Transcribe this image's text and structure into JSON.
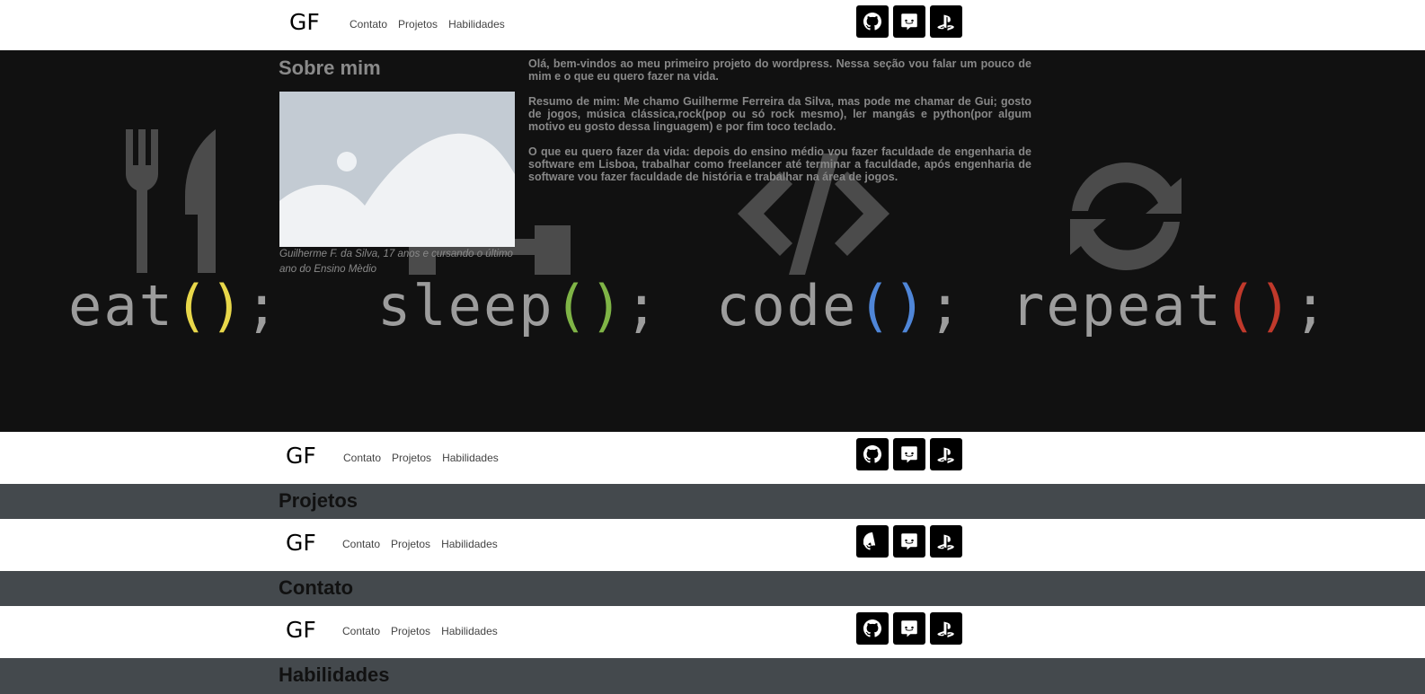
{
  "brand": {
    "logo": "GF"
  },
  "nav": {
    "contato": "Contato",
    "projetos": "Projetos",
    "habilidades": "Habilidades"
  },
  "social": [
    {
      "name": "github",
      "icon": "github-icon"
    },
    {
      "name": "discord",
      "icon": "discord-icon"
    },
    {
      "name": "playstation",
      "icon": "playstation-icon"
    }
  ],
  "hero": {
    "words": [
      "eat",
      "sleep",
      "code",
      "repeat"
    ],
    "paren_open": "(",
    "paren_close": ")",
    "semicolon": ";",
    "paren_colors": [
      "#e8d74a",
      "#7fb446",
      "#4f86d8",
      "#c0392b"
    ],
    "icons": [
      "fork-knife-icon",
      "bed-icon",
      "code-brackets-icon",
      "refresh-icon"
    ]
  },
  "about": {
    "title": "Sobre mim",
    "caption": "Guilherme F. da Silva, 17 anos e cursando o último ano do Ensino Mèdio",
    "p1": "Olá, bem-vindos ao meu primeiro projeto do wordpress. Nessa seção vou falar um pouco de mim e o que eu quero fazer na vida.",
    "p2": "Resumo de mim: Me chamo Guilherme Ferreira da Silva, mas pode me chamar de Gui; gosto de jogos, música clássica,rock(pop ou só rock mesmo), ler mangás e python(por algum motivo eu gosto dessa linguagem) e por fim toco teclado.",
    "p3": "O que eu quero fazer da vida: depois do ensino médio vou fazer faculdade de engenharia de software em Lisboa, trabalhar como freelancer até terminar a faculdade, após engenharia de software vou fazer faculdade de história e trabalhar na área de jogos."
  },
  "sections": {
    "projetos": "Projetos",
    "contato": "Contato",
    "habilidades": "Habilidades"
  }
}
